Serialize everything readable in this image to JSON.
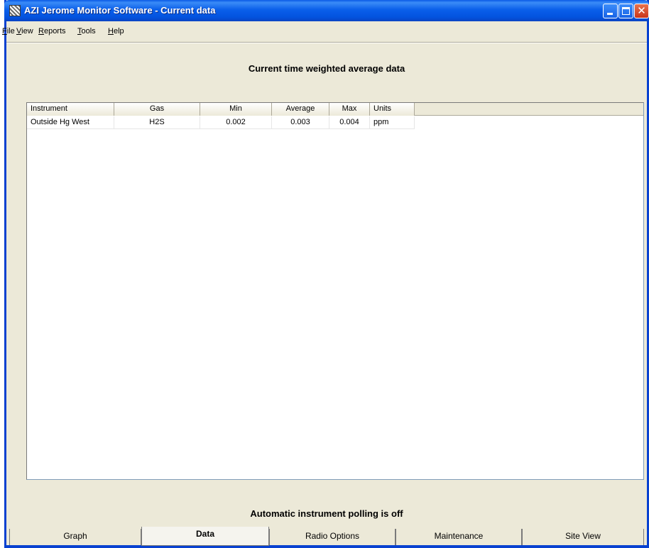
{
  "window": {
    "title": "AZI Jerome Monitor Software - Current data",
    "buttons": {
      "minimize": "minimize-icon",
      "maximize": "maximize-icon",
      "close": "close-icon"
    }
  },
  "menubar": {
    "file": {
      "ul": "F",
      "rest": "ile"
    },
    "view": {
      "ul": "V",
      "rest": "iew"
    },
    "reports": {
      "ul": "R",
      "rest": "eports"
    },
    "tools": {
      "ul": "T",
      "rest": "ools"
    },
    "help": {
      "ul": "H",
      "rest": "elp"
    }
  },
  "main": {
    "heading": "Current time weighted average data",
    "table": {
      "columns": [
        "Instrument",
        "Gas",
        "Min",
        "Average",
        "Max",
        "Units"
      ],
      "rows": [
        [
          "Outside Hg West",
          "H2S",
          "0.002",
          "0.003",
          "0.004",
          "ppm"
        ]
      ]
    },
    "polling_status": "Automatic instrument polling is off"
  },
  "tabs": [
    {
      "label": "Graph",
      "active": false
    },
    {
      "label": "Data",
      "active": true
    },
    {
      "label": "Radio Options",
      "active": false
    },
    {
      "label": "Maintenance",
      "active": false
    },
    {
      "label": "Site View",
      "active": false
    }
  ],
  "colors": {
    "titlebar": "#0a5fea",
    "window_bg": "#ece9d8",
    "close_button": "#c9351a"
  }
}
